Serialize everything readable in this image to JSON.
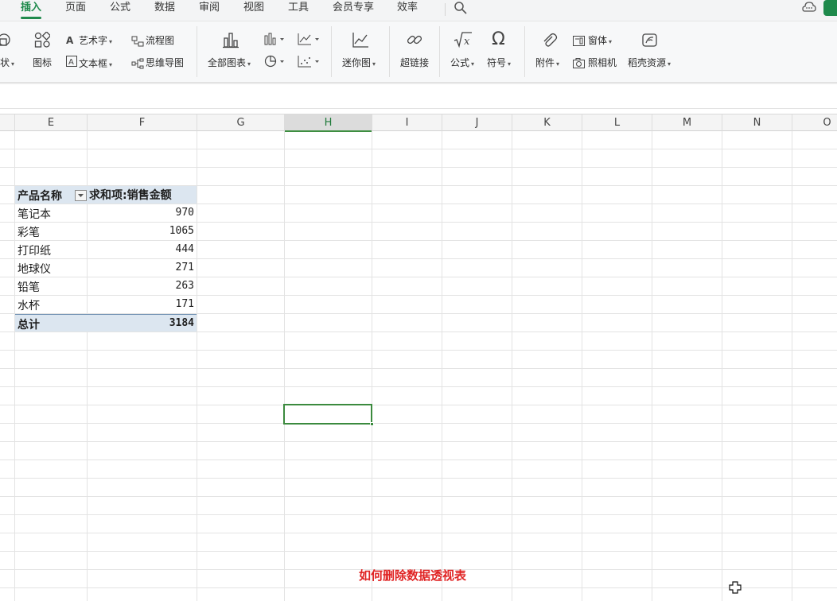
{
  "menu": {
    "tabs": [
      "插入",
      "页面",
      "公式",
      "数据",
      "审阅",
      "视图",
      "工具",
      "会员专享",
      "效率"
    ],
    "active": "插入",
    "icons": [
      "search-icon",
      "chat-icon"
    ]
  },
  "ribbon": {
    "shape_partial": "状",
    "icon_label": "图标",
    "art_text": "艺术字",
    "text_box": "文本框",
    "flowchart": "流程图",
    "mind_map": "思维导图",
    "all_charts": "全部图表",
    "sparkline": "迷你图",
    "hyperlink": "超链接",
    "formula": "公式",
    "symbol": "符号",
    "attachment": "附件",
    "form": "窗体",
    "camera": "照相机",
    "resources": "稻壳资源"
  },
  "columns": [
    "E",
    "F",
    "G",
    "H",
    "I",
    "J",
    "K",
    "L",
    "M",
    "N",
    "O"
  ],
  "selected_column": "H",
  "pivot": {
    "header_name": "产品名称",
    "header_value": "求和项:销售金额",
    "rows": [
      {
        "name": "笔记本",
        "value": "970"
      },
      {
        "name": "彩笔",
        "value": "1065"
      },
      {
        "name": "打印纸",
        "value": "444"
      },
      {
        "name": "地球仪",
        "value": "271"
      },
      {
        "name": "铅笔",
        "value": "263"
      },
      {
        "name": "水杯",
        "value": "171"
      }
    ],
    "total_label": "总计",
    "total_value": "3184"
  },
  "caption": "如何删除数据透视表",
  "colors": {
    "accent": "#1f8a4c",
    "pivot_header_bg": "#dce6f0",
    "caption": "#e02424",
    "selection": "#3b8a3e"
  }
}
